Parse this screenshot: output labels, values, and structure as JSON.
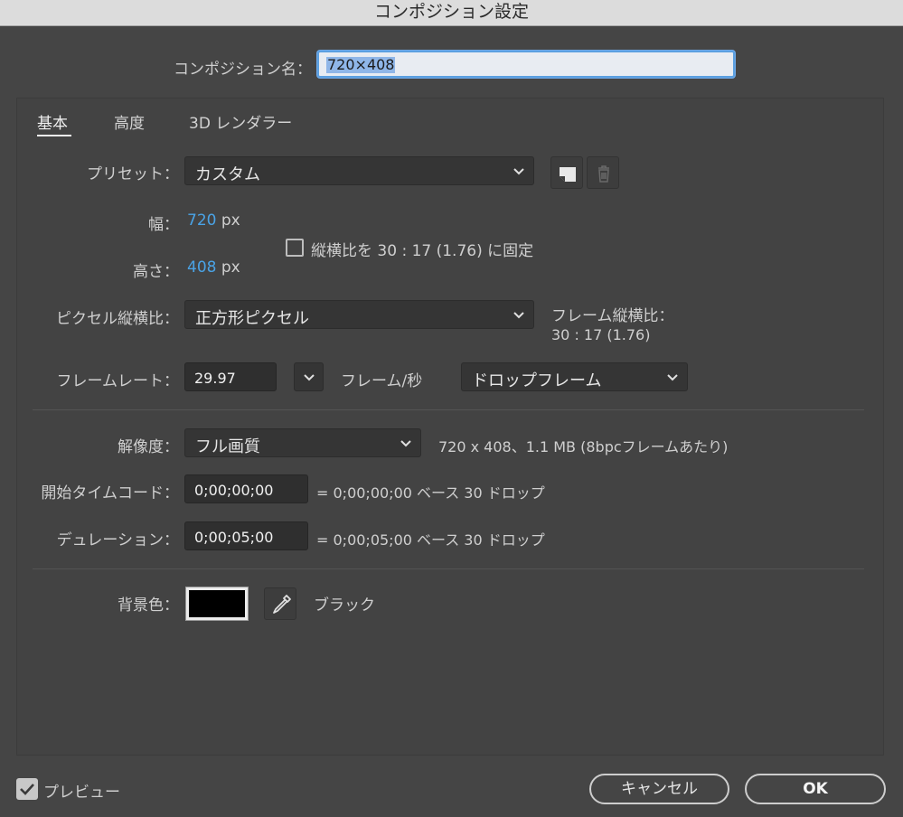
{
  "window": {
    "title": "コンポジション設定"
  },
  "comp_name": {
    "label": "コンポジション名：",
    "value": "720×408"
  },
  "tabs": [
    {
      "label": "基本",
      "active": true
    },
    {
      "label": "高度",
      "active": false
    },
    {
      "label": "3D レンダラー",
      "active": false
    }
  ],
  "preset": {
    "label": "プリセット：",
    "value": "カスタム"
  },
  "width": {
    "label": "幅：",
    "value": "720",
    "unit": "px"
  },
  "height": {
    "label": "高さ：",
    "value": "408",
    "unit": "px"
  },
  "lock_aspect": {
    "label": "縦横比を 30 : 17 (1.76) に固定",
    "checked": false
  },
  "pixel_aspect": {
    "label": "ピクセル縦横比：",
    "value": "正方形ピクセル"
  },
  "frame_aspect": {
    "label": "フレーム縦横比：",
    "value": "30 : 17 (1.76)"
  },
  "frame_rate": {
    "label": "フレームレート：",
    "value": "29.97",
    "unit": "フレーム/秒",
    "mode": "ドロップフレーム"
  },
  "resolution": {
    "label": "解像度：",
    "value": "フル画質",
    "info": "720 x 408、1.1 MB (8bpcフレームあたり)"
  },
  "start_timecode": {
    "label": "開始タイムコード：",
    "value": "0;00;00;00",
    "info": "= 0;00;00;00  ベース 30  ドロップ"
  },
  "duration": {
    "label": "デュレーション：",
    "value": "0;00;05;00",
    "info": "= 0;00;05;00  ベース 30  ドロップ"
  },
  "background": {
    "label": "背景色：",
    "color_name": "ブラック",
    "color": "#000000"
  },
  "footer": {
    "preview_label": "プレビュー",
    "preview_checked": true,
    "cancel_label": "キャンセル",
    "ok_label": "OK"
  },
  "colors": {
    "value_blue": "#4aa3e6",
    "background": "#454545",
    "titlebar": "#dcdcdc"
  }
}
